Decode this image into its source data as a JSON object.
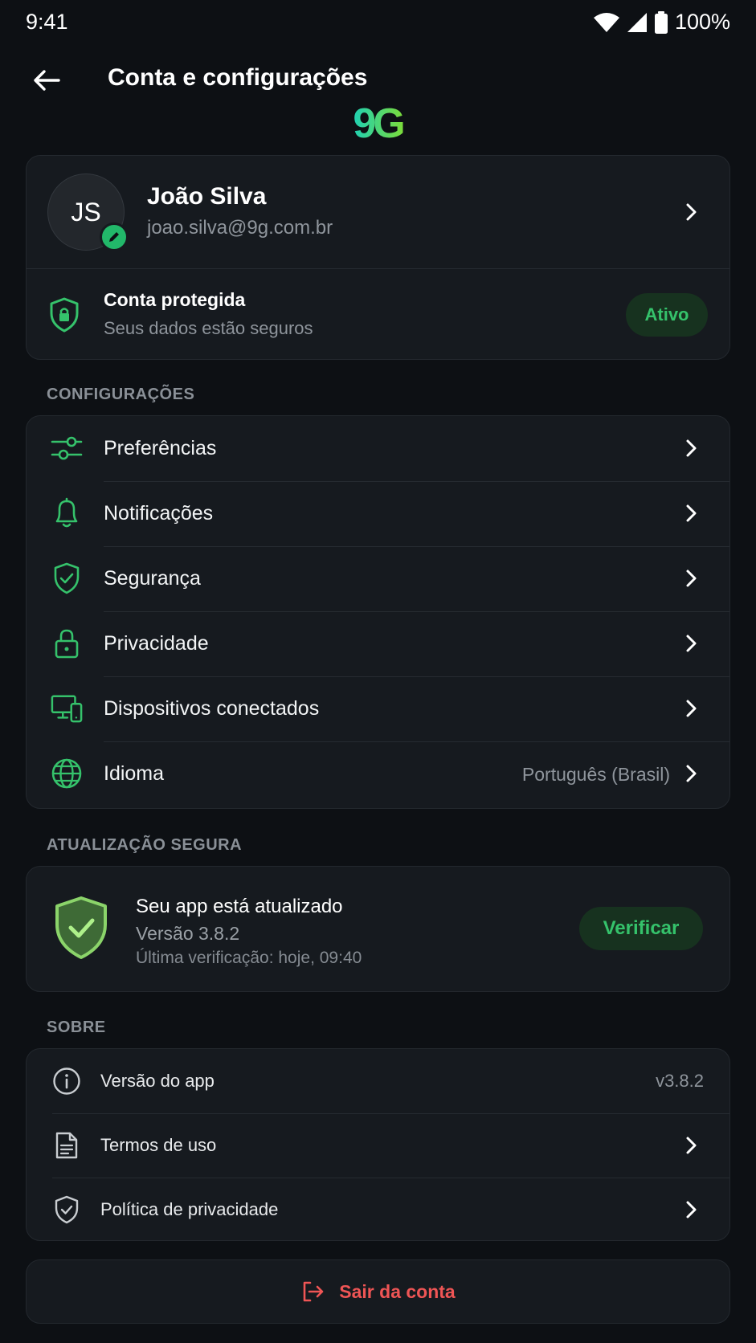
{
  "status_bar": {
    "time": "9:41",
    "battery": "100%"
  },
  "header": {
    "title": "Conta e configurações",
    "logo_text": "9G"
  },
  "profile": {
    "initials": "JS",
    "name": "João Silva",
    "email": "joao.silva@9g.com.br",
    "protection_title": "Conta protegida",
    "protection_subtitle": "Seus dados estão seguros",
    "protection_badge": "Ativo"
  },
  "settings": {
    "section_label": "CONFIGURAÇÕES",
    "items": [
      {
        "label": "Preferências",
        "icon": "sliders-icon"
      },
      {
        "label": "Notificações",
        "icon": "bell-icon"
      },
      {
        "label": "Segurança",
        "icon": "shield-check-icon"
      },
      {
        "label": "Privacidade",
        "icon": "lock-icon"
      },
      {
        "label": "Dispositivos conectados",
        "icon": "devices-icon"
      },
      {
        "label": "Idioma",
        "icon": "globe-icon",
        "value": "Português (Brasil)"
      }
    ]
  },
  "update": {
    "section_label": "ATUALIZAÇÃO SEGURA",
    "title": "Seu app está atualizado",
    "version": "Versão 3.8.2",
    "last_check": "Última verificação: hoje, 09:40",
    "button": "Verificar"
  },
  "about": {
    "section_label": "SOBRE",
    "items": [
      {
        "label": "Versão do app",
        "icon": "info-icon",
        "value": "v3.8.2"
      },
      {
        "label": "Termos de uso",
        "icon": "document-icon"
      },
      {
        "label": "Política de privacidade",
        "icon": "shield-icon"
      }
    ]
  },
  "logout": {
    "label": "Sair da conta"
  },
  "colors": {
    "accent": "#35c26b",
    "danger": "#ef5555",
    "background": "#0d1014",
    "card": "#161a1f"
  }
}
